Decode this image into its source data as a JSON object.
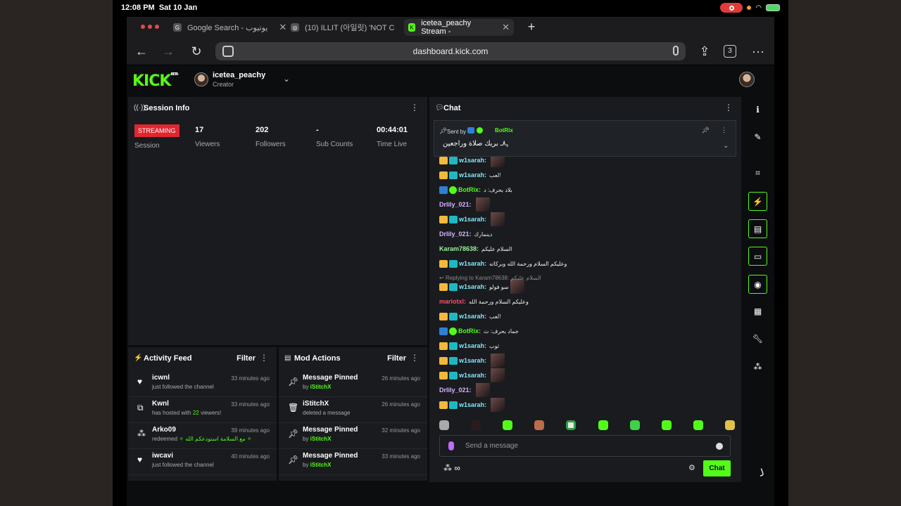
{
  "status_bar": {
    "time": "12:08 PM",
    "date": "Sat 10 Jan"
  },
  "browser": {
    "tabs": [
      {
        "favicon": "G",
        "title": "Google Search - يوتيوب"
      },
      {
        "favicon": "◎",
        "title": "(10) ILLIT (아일릿) 'NOT C"
      },
      {
        "favicon": "K",
        "title": "icetea_peachy Stream -"
      }
    ],
    "url": "dashboard.kick.com",
    "tab_count": "3"
  },
  "header": {
    "logo": "KICK",
    "logo_badge": "BETA",
    "channel_name": "icetea_peachy",
    "channel_role": "Creator"
  },
  "session": {
    "title": "Session Info",
    "status_badge": "STREAMING",
    "status_label": "Session",
    "stats": [
      {
        "value": "17",
        "label": "Viewers"
      },
      {
        "value": "202",
        "label": "Followers"
      },
      {
        "value": "-",
        "label": "Sub Counts"
      },
      {
        "value": "00:44:01",
        "label": "Time Live"
      }
    ]
  },
  "activity_feed": {
    "title": "Activity Feed",
    "filter_label": "Filter",
    "items": [
      {
        "icon": "heart-icon",
        "name": "icwnl",
        "time": "33 minutes ago",
        "desc": "just followed the channel",
        "highlight": "",
        "desc_after": ""
      },
      {
        "icon": "host-icon",
        "name": "Kwnl",
        "time": "33 minutes ago",
        "desc": "has hosted with ",
        "highlight": "22",
        "desc_after": " viewers!"
      },
      {
        "icon": "points-icon",
        "name": "Arko09",
        "time": "39 minutes ago",
        "desc": "redeemed ",
        "highlight": "✧ مع السلامة استودعكم الله ✧",
        "desc_after": ""
      },
      {
        "icon": "heart-icon",
        "name": "iwcavi",
        "time": "40 minutes ago",
        "desc": "just followed the channel",
        "highlight": "",
        "desc_after": ""
      }
    ]
  },
  "mod_actions": {
    "title": "Mod Actions",
    "filter_label": "Filter",
    "items": [
      {
        "icon": "pin-icon",
        "name": "Message Pinned",
        "time": "26 minutes ago",
        "desc": "by ",
        "by": "iStitchX"
      },
      {
        "icon": "trash-icon",
        "name": "iStitchX",
        "time": "26 minutes ago",
        "desc": "deleted a message",
        "by": ""
      },
      {
        "icon": "pin-icon",
        "name": "Message Pinned",
        "time": "32 minutes ago",
        "desc": "by ",
        "by": "iStitchX"
      },
      {
        "icon": "pin-icon",
        "name": "Message Pinned",
        "time": "33 minutes ago",
        "desc": "by ",
        "by": "iStitchX"
      }
    ]
  },
  "chat": {
    "title": "Chat",
    "pinned": {
      "label": "Sent by",
      "author": "BotRix",
      "text": "ﮩ٨ـ بريك صلاة وراجعين"
    },
    "reply_line": "Replying to Karam78638: السلام عليكم",
    "messages": [
      {
        "badges": [
          "crown",
          "sub"
        ],
        "user": "w1sarah:",
        "color": "#7ee8fa",
        "text": "",
        "emote": true
      },
      {
        "badges": [
          "crown",
          "sub"
        ],
        "user": "w1sarah:",
        "color": "#7ee8fa",
        "text": "لعب!",
        "emote": false
      },
      {
        "badges": [
          "bot",
          "verif"
        ],
        "user": "BotRix:",
        "color": "#53fc18",
        "text": "بلاد بحرف: د",
        "emote": false
      },
      {
        "badges": [],
        "user": "Drlily_021:",
        "color": "#d7b3ff",
        "text": "",
        "emote": true
      },
      {
        "badges": [
          "crown",
          "sub"
        ],
        "user": "w1sarah:",
        "color": "#7ee8fa",
        "text": "",
        "emote": true
      },
      {
        "badges": [],
        "user": "Drlily_021:",
        "color": "#d7b3ff",
        "text": "دينمارك",
        "emote": false
      },
      {
        "badges": [],
        "user": "Karam78638:",
        "color": "#9cf29c",
        "text": "السلام عليكم",
        "emote": false
      },
      {
        "badges": [
          "crown",
          "sub"
        ],
        "user": "w1sarah:",
        "color": "#7ee8fa",
        "text": "وعليكم السلام ورحمة الله وبركاته",
        "emote": false
      },
      {
        "badges": [
          "crown",
          "sub"
        ],
        "user": "w1sarah:",
        "color": "#7ee8fa",
        "text": "سو فولو",
        "emote": true
      },
      {
        "badges": [],
        "user": "mariotxl:",
        "color": "#ff4d6d",
        "text": "وعليكم السلام ورحمة الله",
        "emote": false
      },
      {
        "badges": [
          "crown",
          "sub"
        ],
        "user": "w1sarah:",
        "color": "#7ee8fa",
        "text": "لعب!",
        "emote": false
      },
      {
        "badges": [
          "bot",
          "verif"
        ],
        "user": "BotRix:",
        "color": "#53fc18",
        "text": "جماد بحرف: ث",
        "emote": false
      },
      {
        "badges": [
          "crown",
          "sub"
        ],
        "user": "w1sarah:",
        "color": "#7ee8fa",
        "text": "ثوب",
        "emote": false
      },
      {
        "badges": [
          "crown",
          "sub"
        ],
        "user": "w1sarah:",
        "color": "#7ee8fa",
        "text": "",
        "emote": true
      },
      {
        "badges": [
          "crown",
          "sub"
        ],
        "user": "w1sarah:",
        "color": "#7ee8fa",
        "text": "",
        "emote": true
      },
      {
        "badges": [],
        "user": "Drlily_021:",
        "color": "#d7b3ff",
        "text": "",
        "emote": true
      },
      {
        "badges": [
          "crown",
          "sub"
        ],
        "user": "w1sarah:",
        "color": "#7ee8fa",
        "text": "",
        "emote": true
      }
    ],
    "input_placeholder": "Send a message",
    "send_label": "Chat",
    "infinity": "∞"
  },
  "right_rail": [
    "info-icon",
    "pencil-icon",
    "scan-icon",
    "lightning-icon",
    "notes-icon",
    "chat-bubble-icon",
    "broadcast-icon",
    "layout-icon",
    "wrench-icon",
    "apps-icon"
  ],
  "colors": {
    "accent": "#53fc18",
    "live": "#e0262f",
    "panel": "#191b1f",
    "bg": "#0b0d0f"
  }
}
